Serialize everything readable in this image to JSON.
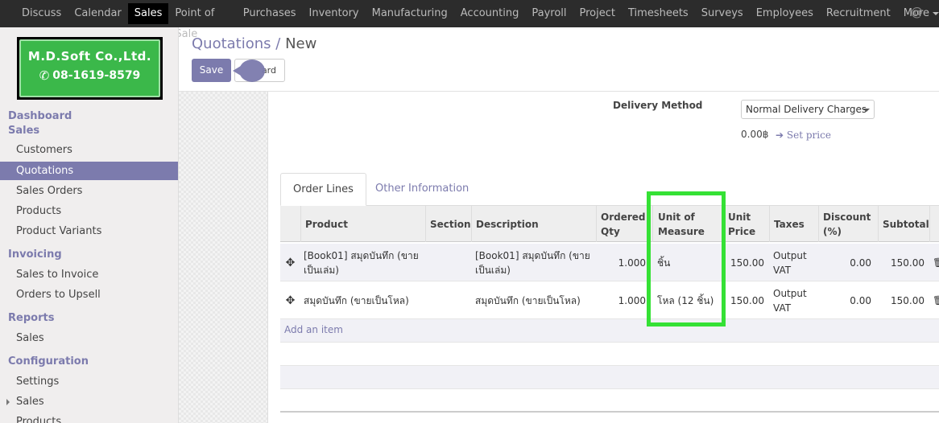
{
  "topnav": {
    "items": [
      "Discuss",
      "Calendar",
      "Sales",
      "Point of Sale",
      "Purchases",
      "Inventory",
      "Manufacturing",
      "Accounting",
      "Payroll",
      "Project",
      "Timesheets",
      "Surveys",
      "Employees",
      "Recruitment",
      "More"
    ],
    "active": "Sales",
    "at_symbol": "@"
  },
  "logo": {
    "company": "M.D.Soft Co.,Ltd.",
    "phone": "08-1619-8579"
  },
  "sidebar": {
    "dashboard": "Dashboard",
    "sales_head": "Sales",
    "sales_items": [
      "Customers",
      "Quotations",
      "Sales Orders",
      "Products",
      "Product Variants"
    ],
    "invoicing_head": "Invoicing",
    "invoicing_items": [
      "Sales to Invoice",
      "Orders to Upsell"
    ],
    "reports_head": "Reports",
    "reports_items": [
      "Sales"
    ],
    "config_head": "Configuration",
    "config_items": [
      "Settings",
      "Sales",
      "Products"
    ]
  },
  "breadcrumb": {
    "parent": "Quotations",
    "separator": "/",
    "current": "New"
  },
  "buttons": {
    "save": "Save",
    "discard": "ard"
  },
  "delivery": {
    "label": "Delivery Method",
    "value": "Normal Delivery Charges",
    "price": "0.00฿",
    "set_price": "Set price"
  },
  "tabs": {
    "order_lines": "Order Lines",
    "other_info": "Other Information"
  },
  "table": {
    "headers": {
      "product": "Product",
      "section": "Section",
      "description": "Description",
      "ordered_qty": [
        "Ordered",
        "Qty"
      ],
      "uom": [
        "Unit of",
        "Measure"
      ],
      "unit_price": [
        "Unit",
        "Price"
      ],
      "taxes": "Taxes",
      "discount": [
        "Discount",
        "(%)"
      ],
      "subtotal": "Subtotal"
    },
    "rows": [
      {
        "product": "[Book01] สมุดบันทึก (ขาย เป็นเล่ม)",
        "description": "[Book01] สมุดบันทึก (ขาย เป็นเล่ม)",
        "qty": "1.000",
        "uom": "ชิ้น",
        "unit_price": "150.00",
        "taxes": "Output VAT",
        "discount": "0.00",
        "subtotal": "150.00"
      },
      {
        "product": "สมุดบันทึก (ขายเป็นโหล)",
        "description": "สมุดบันทึก (ขายเป็นโหล)",
        "qty": "1.000",
        "uom": "โหล (12 ชิ้น)",
        "unit_price": "150.00",
        "taxes": "Output VAT",
        "discount": "0.00",
        "subtotal": "150.00"
      }
    ],
    "add_item": "Add an item"
  },
  "colors": {
    "accent": "#7c7bad",
    "highlight": "#35e135",
    "topbar": "#2c2c2c"
  }
}
